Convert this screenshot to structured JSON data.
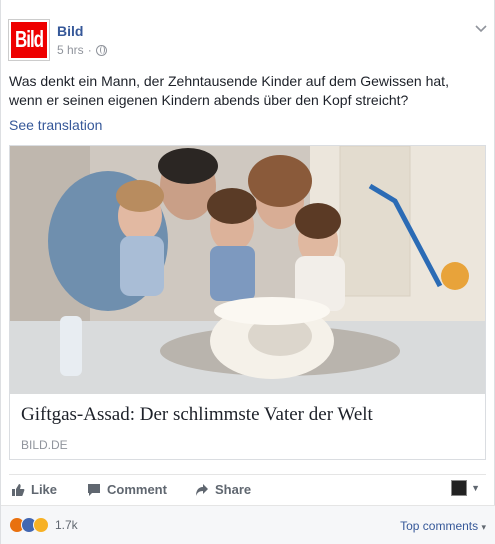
{
  "post": {
    "page_name": "Bild",
    "logo_text": "Bild",
    "time": "5 hrs",
    "separator": "·",
    "text": "Was denkt ein Mann, der Zehntausende Kinder auf dem Gewissen hat, wenn er seinen eigenen Kindern abends über den Kopf streicht?",
    "see_translation": "See translation"
  },
  "link": {
    "title": "Giftgas-Assad: Der schlimmste Vater der Welt",
    "domain": "BILD.DE"
  },
  "actions": {
    "like": "Like",
    "comment": "Comment",
    "share": "Share"
  },
  "reactions": {
    "count": "1.7k",
    "types": [
      "angry",
      "like",
      "sad"
    ]
  },
  "footer": {
    "top_comments": "Top comments"
  },
  "colors": {
    "brand_red": "#e00000",
    "link_blue": "#365899",
    "meta_gray": "#90949c"
  }
}
